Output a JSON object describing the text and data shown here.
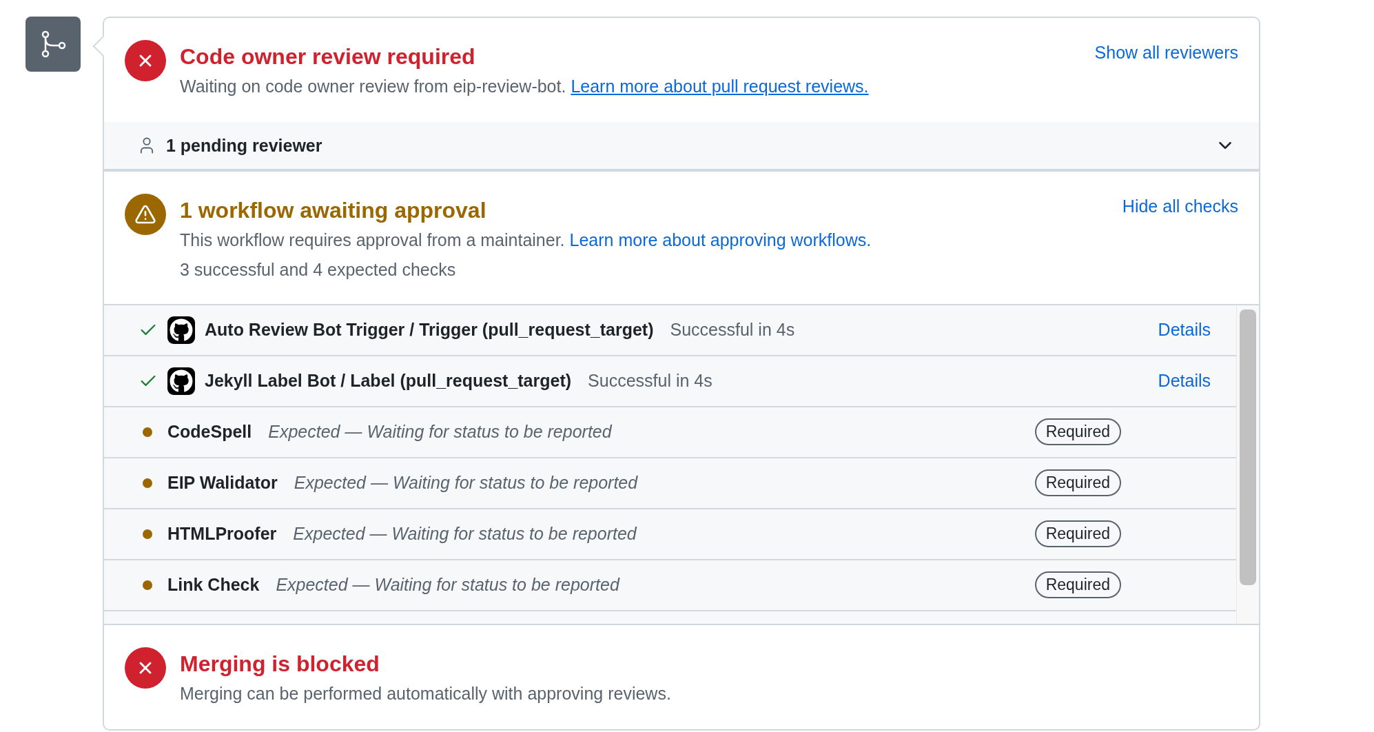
{
  "reviews": {
    "kind": "failure",
    "title": "Code owner review required",
    "description": "Waiting on code owner review from eip-review-bot.",
    "link": "Learn more about pull request reviews.",
    "action": "Show all reviewers"
  },
  "pending_reviewers": {
    "label": "1 pending reviewer",
    "expanded": false
  },
  "checks_summary": {
    "kind": "warning",
    "title": "1 workflow awaiting approval",
    "description": "This workflow requires approval from a maintainer.",
    "link": "Learn more about approving workflows.",
    "summary": "3 successful and 4 expected checks",
    "action": "Hide all checks"
  },
  "checks": [
    {
      "kind": "success",
      "name": "Auto Review Bot Trigger / Trigger (pull_request_target)",
      "status": "Successful in 4s",
      "action": "Details"
    },
    {
      "kind": "success",
      "name": "Jekyll Label Bot / Label (pull_request_target)",
      "status": "Successful in 4s",
      "action": "Details"
    },
    {
      "kind": "expected",
      "name": "CodeSpell",
      "status": "Expected — Waiting for status to be reported",
      "badge": "Required"
    },
    {
      "kind": "expected",
      "name": "EIP Walidator",
      "status": "Expected — Waiting for status to be reported",
      "badge": "Required"
    },
    {
      "kind": "expected",
      "name": "HTMLProofer",
      "status": "Expected — Waiting for status to be reported",
      "badge": "Required"
    },
    {
      "kind": "expected",
      "name": "Link Check",
      "status": "Expected — Waiting for status to be reported",
      "badge": "Required"
    }
  ],
  "merge": {
    "kind": "failure",
    "title": "Merging is blocked",
    "description": "Merging can be performed automatically with approving reviews."
  }
}
